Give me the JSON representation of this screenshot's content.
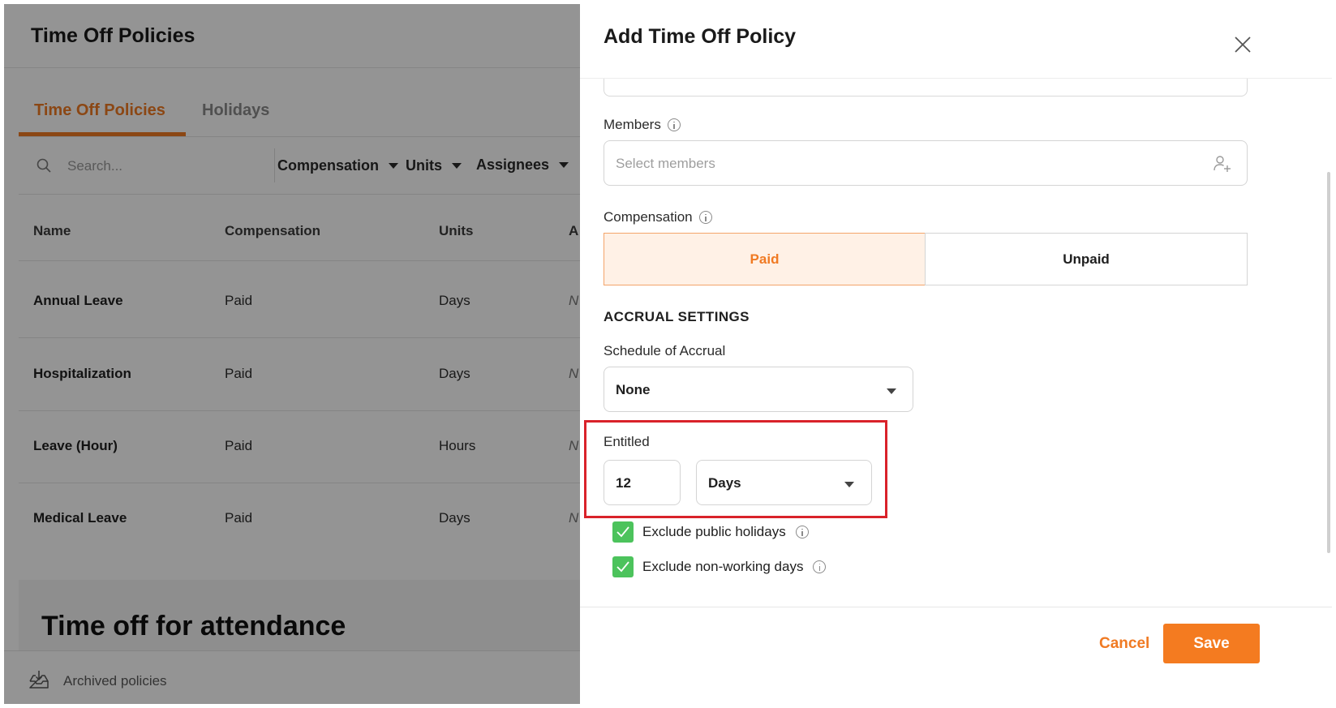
{
  "page": {
    "title": "Time Off Policies",
    "tabs": [
      {
        "label": "Time Off Policies",
        "active": true
      },
      {
        "label": "Holidays",
        "active": false
      }
    ],
    "search_placeholder": "Search...",
    "filters": [
      "Compensation",
      "Units",
      "Assignees"
    ],
    "table": {
      "headers": [
        "Name",
        "Compensation",
        "Units",
        "A"
      ],
      "rows": [
        {
          "name": "Annual Leave",
          "compensation": "Paid",
          "units": "Days",
          "extra": "N"
        },
        {
          "name": "Hospitalization",
          "compensation": "Paid",
          "units": "Days",
          "extra": "N"
        },
        {
          "name": "Leave (Hour)",
          "compensation": "Paid",
          "units": "Hours",
          "extra": "N"
        },
        {
          "name": "Medical Leave",
          "compensation": "Paid",
          "units": "Days",
          "extra": "N"
        }
      ]
    },
    "section_title": "Time off for attendance",
    "archived_label": "Archived policies"
  },
  "drawer": {
    "title": "Add Time Off Policy",
    "members": {
      "label": "Members",
      "placeholder": "Select members"
    },
    "compensation": {
      "label": "Compensation",
      "options": [
        "Paid",
        "Unpaid"
      ],
      "selected": "Paid"
    },
    "accrual_heading": "ACCRUAL SETTINGS",
    "schedule": {
      "label": "Schedule of Accrual",
      "value": "None"
    },
    "entitled": {
      "label": "Entitled",
      "amount": "12",
      "unit": "Days"
    },
    "checks": [
      {
        "label": "Exclude public holidays",
        "checked": true
      },
      {
        "label": "Exclude non-working days",
        "checked": true
      }
    ],
    "cancel_label": "Cancel",
    "save_label": "Save"
  },
  "colors": {
    "accent": "#f07a23",
    "check_green": "#4cc35c",
    "highlight_red": "#d9222a"
  }
}
